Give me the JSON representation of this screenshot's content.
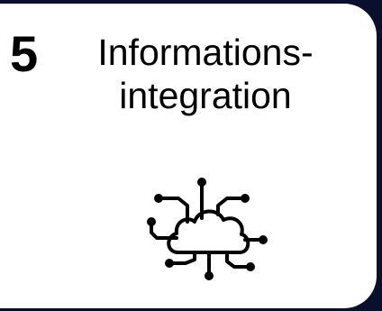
{
  "card": {
    "number": "5",
    "title_line1": "Informations-",
    "title_line2": "integration",
    "icon": "cloud-network-icon"
  },
  "colors": {
    "background": "#0a0f2e",
    "card": "#ffffff",
    "text": "#000000"
  }
}
